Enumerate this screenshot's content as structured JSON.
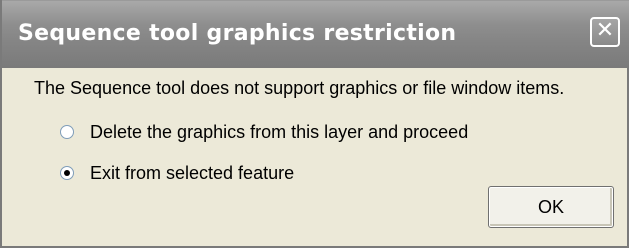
{
  "window": {
    "title": "Sequence tool graphics restriction",
    "close_glyph": "✕"
  },
  "message": "The Sequence tool does not support graphics or file window items.",
  "options": [
    {
      "label": "Delete the graphics from this layer and proceed",
      "selected": false
    },
    {
      "label": "Exit from selected feature",
      "selected": true
    }
  ],
  "buttons": {
    "ok_label": "OK"
  },
  "colors": {
    "titlebar": "#8e8e8e",
    "body": "#ece9d8"
  }
}
